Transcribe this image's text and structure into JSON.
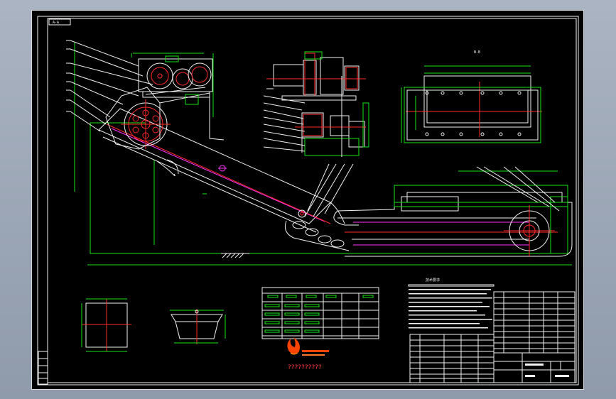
{
  "drawing": {
    "title_tag": "A-A",
    "section_label": "B-B",
    "notes_title": "技术要求",
    "watermark_text": "??????????",
    "accent_colors": {
      "background": "#000000",
      "outline": "#f2f2f2",
      "dimension": "#19e619",
      "centerline": "#ff2a2a",
      "chain_path": "#ff33ff",
      "logo": "#ff4400"
    },
    "logo_icon": "flame-logo-icon"
  }
}
